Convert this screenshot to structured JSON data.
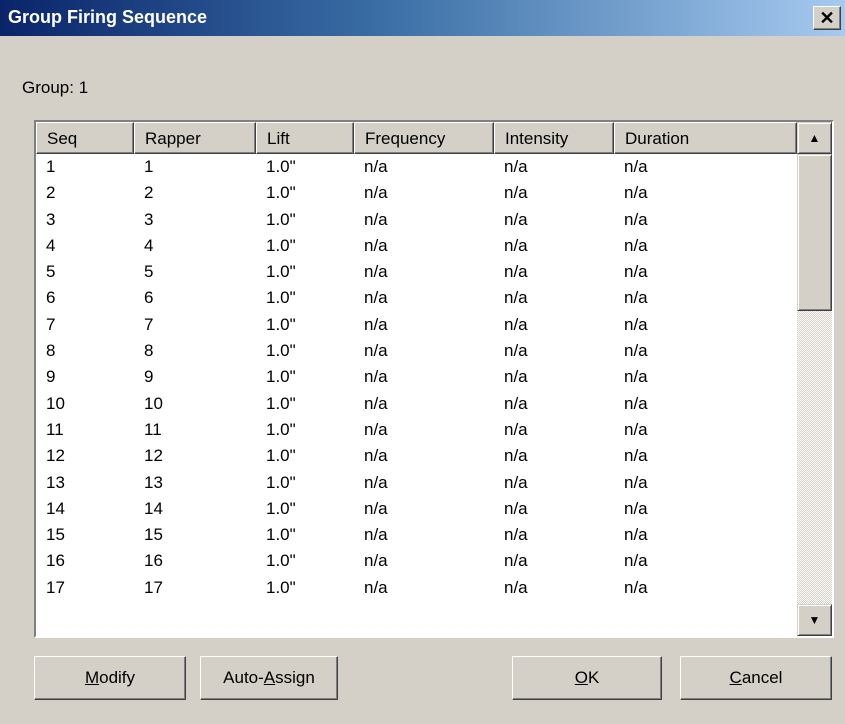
{
  "dialog": {
    "title": "Group Firing Sequence",
    "close_glyph": "✕",
    "group_label": "Group:  1"
  },
  "list": {
    "columns": [
      "Seq",
      "Rapper",
      "Lift",
      "Frequency",
      "Intensity",
      "Duration"
    ],
    "rows": [
      [
        "1",
        "1",
        "1.0\"",
        "n/a",
        "n/a",
        "n/a"
      ],
      [
        "2",
        "2",
        "1.0\"",
        "n/a",
        "n/a",
        "n/a"
      ],
      [
        "3",
        "3",
        "1.0\"",
        "n/a",
        "n/a",
        "n/a"
      ],
      [
        "4",
        "4",
        "1.0\"",
        "n/a",
        "n/a",
        "n/a"
      ],
      [
        "5",
        "5",
        "1.0\"",
        "n/a",
        "n/a",
        "n/a"
      ],
      [
        "6",
        "6",
        "1.0\"",
        "n/a",
        "n/a",
        "n/a"
      ],
      [
        "7",
        "7",
        "1.0\"",
        "n/a",
        "n/a",
        "n/a"
      ],
      [
        "8",
        "8",
        "1.0\"",
        "n/a",
        "n/a",
        "n/a"
      ],
      [
        "9",
        "9",
        "1.0\"",
        "n/a",
        "n/a",
        "n/a"
      ],
      [
        "10",
        "10",
        "1.0\"",
        "n/a",
        "n/a",
        "n/a"
      ],
      [
        "11",
        "11",
        "1.0\"",
        "n/a",
        "n/a",
        "n/a"
      ],
      [
        "12",
        "12",
        "1.0\"",
        "n/a",
        "n/a",
        "n/a"
      ],
      [
        "13",
        "13",
        "1.0\"",
        "n/a",
        "n/a",
        "n/a"
      ],
      [
        "14",
        "14",
        "1.0\"",
        "n/a",
        "n/a",
        "n/a"
      ],
      [
        "15",
        "15",
        "1.0\"",
        "n/a",
        "n/a",
        "n/a"
      ],
      [
        "16",
        "16",
        "1.0\"",
        "n/a",
        "n/a",
        "n/a"
      ],
      [
        "17",
        "17",
        "1.0\"",
        "n/a",
        "n/a",
        "n/a"
      ]
    ],
    "scroll_up_glyph": "▲",
    "scroll_down_glyph": "▼"
  },
  "buttons": {
    "modify": {
      "pre": "",
      "key": "M",
      "post": "odify"
    },
    "auto_assign": {
      "pre": "Auto-",
      "key": "A",
      "post": "ssign"
    },
    "ok": {
      "pre": "",
      "key": "O",
      "post": "K"
    },
    "cancel": {
      "pre": "",
      "key": "C",
      "post": "ancel"
    }
  },
  "colors": {
    "titlebar_start": "#0a246a",
    "titlebar_end": "#a6caf0",
    "face": "#d4d0c8"
  }
}
